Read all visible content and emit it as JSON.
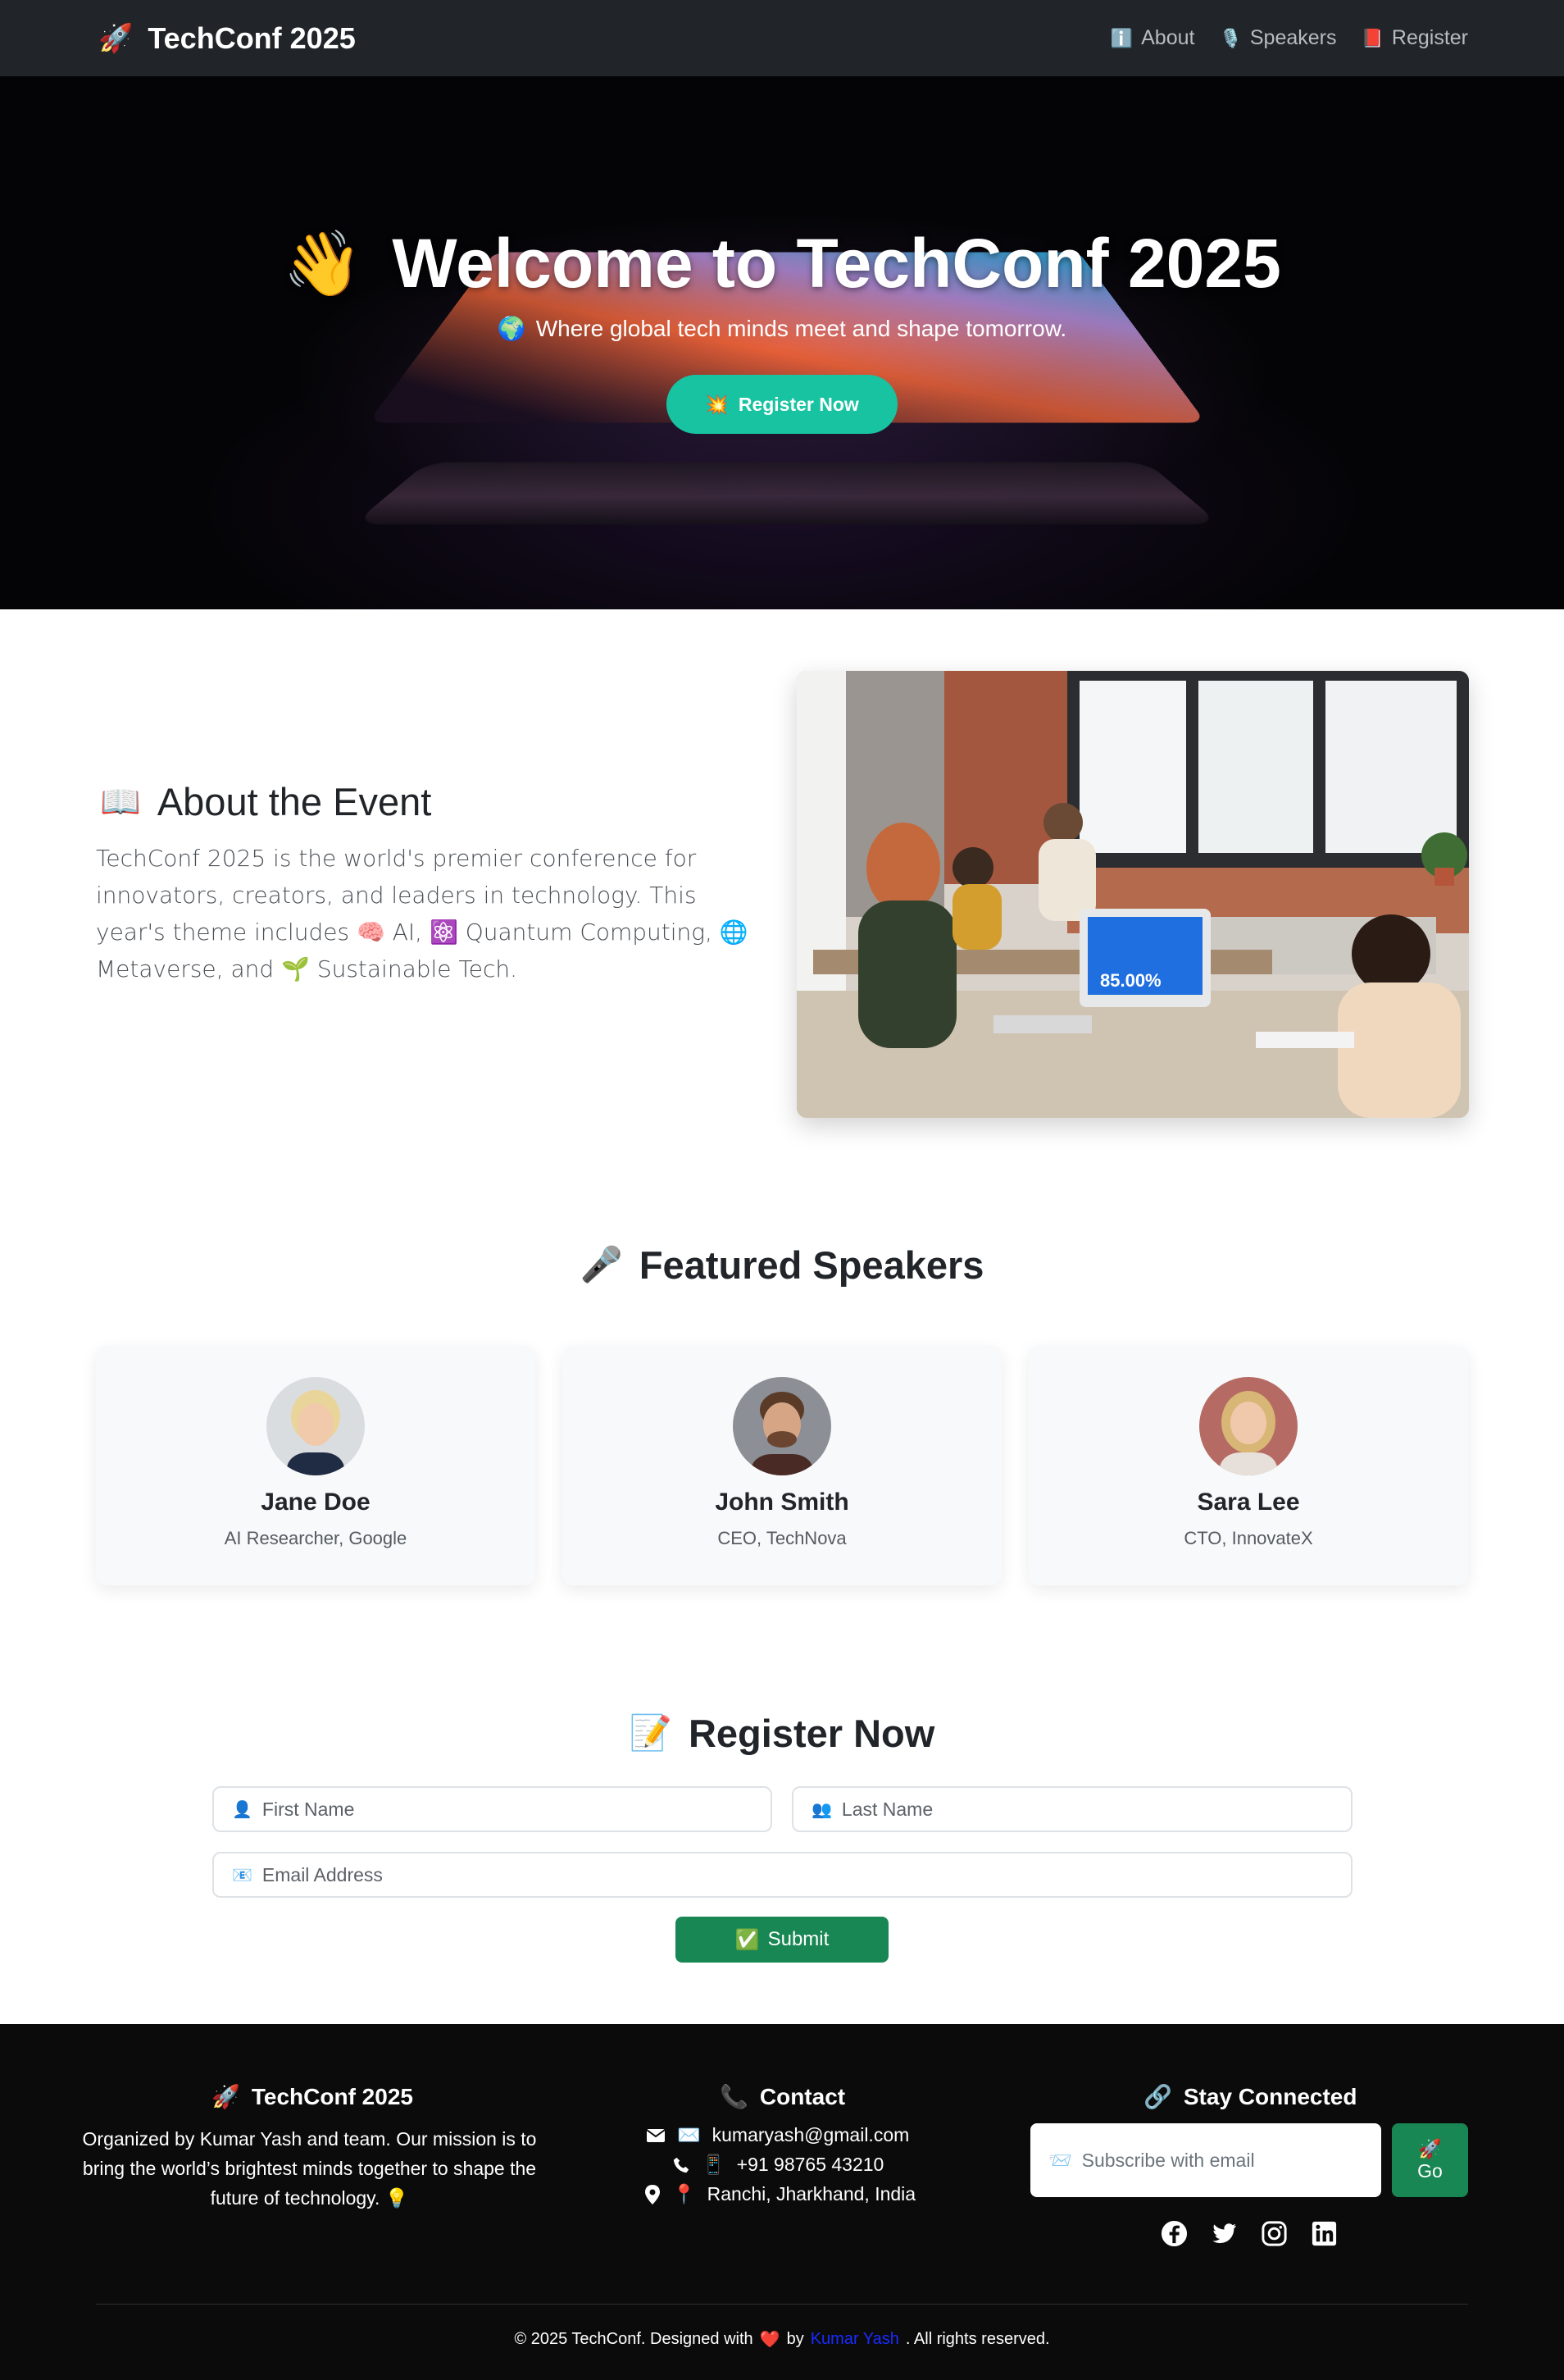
{
  "navbar": {
    "brand_icon": "🚀",
    "brand": "TechConf 2025",
    "links": [
      {
        "icon": "ℹ️",
        "label": "About"
      },
      {
        "icon": "🎙️",
        "label": "Speakers"
      },
      {
        "icon": "📕",
        "label": "Register"
      }
    ]
  },
  "hero": {
    "title_icon": "👋",
    "title": "Welcome to TechConf 2025",
    "subtitle_icon": "🌍",
    "subtitle": "Where global tech minds meet and shape tomorrow.",
    "button_icon": "💥",
    "button_label": "Register Now"
  },
  "about": {
    "heading_icon": "📖",
    "heading": "About the Event",
    "body_intro": "TechConf 2025 is the world's premier conference for innovators, creators, and leaders in technology. This year's theme includes",
    "themes": [
      {
        "icon": "🧠",
        "label": "AI,"
      },
      {
        "icon": "⚛️",
        "label": "Quantum Computing,"
      },
      {
        "icon": "🌐",
        "label": "Metaverse, and"
      },
      {
        "icon": "🌱",
        "label": "Sustainable Tech."
      }
    ]
  },
  "speakers": {
    "heading_icon": "🎤",
    "heading": "Featured Speakers",
    "items": [
      {
        "name": "Jane Doe",
        "role": "AI Researcher, Google"
      },
      {
        "name": "John Smith",
        "role": "CEO, TechNova"
      },
      {
        "name": "Sara Lee",
        "role": "CTO, InnovateX"
      }
    ]
  },
  "register": {
    "heading_icon": "📝",
    "heading": "Register Now",
    "first_name_icon": "👤",
    "first_name_placeholder": "First Name",
    "last_name_icon": "👥",
    "last_name_placeholder": "Last Name",
    "email_icon": "📧",
    "email_placeholder": "Email Address",
    "submit_icon": "✅",
    "submit_label": "Submit"
  },
  "footer": {
    "about_icon": "🚀",
    "about_title": "TechConf 2025",
    "about_text": "Organized by Kumar Yash and team. Our mission is to bring the world’s brightest minds together to shape the future of technology. 💡",
    "contact_icon": "📞",
    "contact_title": "Contact",
    "email": "kumaryash@gmail.com",
    "phone": "+91 98765 43210",
    "location": "Ranchi, Jharkhand, India",
    "email_emoji": "✉️",
    "phone_emoji": "📱",
    "location_emoji": "📍",
    "connect_icon": "🔗",
    "connect_title": "Stay Connected",
    "subscribe_icon": "📨",
    "subscribe_placeholder": "Subscribe with email",
    "go_icon": "🚀",
    "go_label": "Go",
    "socials": [
      "facebook-icon",
      "twitter-icon",
      "instagram-icon",
      "linkedin-icon"
    ],
    "copyright_prefix": "© 2025 TechConf. Designed with",
    "heart": "❤️",
    "by": "by",
    "author": "Kumar Yash",
    "copyright_suffix": ". All rights reserved."
  }
}
